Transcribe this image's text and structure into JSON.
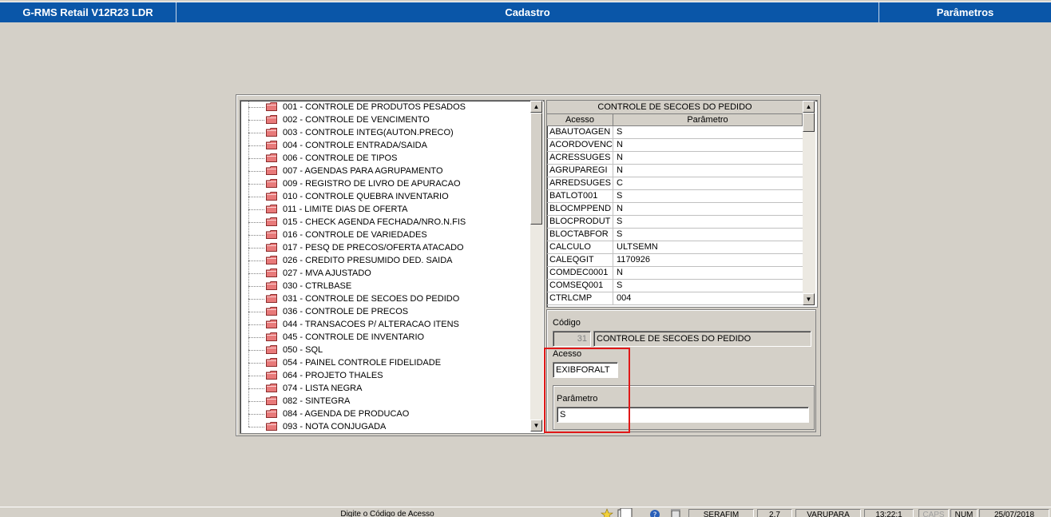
{
  "titlebar": {
    "app": "G-RMS Retail V12R23 LDR",
    "module": "Cadastro",
    "screen": "Parâmetros"
  },
  "tree": {
    "items": [
      "001 - CONTROLE DE PRODUTOS PESADOS",
      "002 - CONTROLE DE VENCIMENTO",
      "003 - CONTROLE INTEG(AUTON.PRECO)",
      "004 - CONTROLE ENTRADA/SAIDA",
      "006 - CONTROLE DE TIPOS",
      "007 - AGENDAS PARA AGRUPAMENTO",
      "009 - REGISTRO DE LIVRO DE APURACAO",
      "010 - CONTROLE QUEBRA INVENTARIO",
      "011 - LIMITE DIAS DE OFERTA",
      "015 - CHECK AGENDA FECHADA/NRO.N.FIS",
      "016 - CONTROLE DE VARIEDADES",
      "017 - PESQ DE PRECOS/OFERTA ATACADO",
      "026 - CREDITO PRESUMIDO DED. SAIDA",
      "027 - MVA AJUSTADO",
      "030 - CTRLBASE",
      "031 - CONTROLE DE SECOES DO PEDIDO",
      "036 - CONTROLE DE PRECOS",
      "044 - TRANSACOES P/ ALTERACAO ITENS",
      "045 - CONTROLE DE INVENTARIO",
      "050 - SQL",
      "054 - PAINEL CONTROLE FIDELIDADE",
      "064 - PROJETO THALES",
      "074 - LISTA NEGRA",
      "082 - SINTEGRA",
      "084 - AGENDA DE PRODUCAO",
      "093 - NOTA CONJUGADA"
    ]
  },
  "grid": {
    "caption": "CONTROLE DE SECOES DO PEDIDO",
    "col_acesso": "Acesso",
    "col_parametro": "Parâmetro",
    "rows": [
      [
        "ABAUTOAGEN",
        "S"
      ],
      [
        "ACORDOVENC",
        "N"
      ],
      [
        "ACRESSUGES",
        "N"
      ],
      [
        "AGRUPAREGI",
        "N"
      ],
      [
        "ARREDSUGES",
        "C"
      ],
      [
        "BATLOT001",
        "S"
      ],
      [
        "BLOCMPPEND",
        "N"
      ],
      [
        "BLOCPRODUT",
        "S"
      ],
      [
        "BLOCTABFOR",
        "S"
      ],
      [
        "CALCULO",
        "ULTSEMN"
      ],
      [
        "CALEQGIT",
        "1170926"
      ],
      [
        "COMDEC0001",
        "N"
      ],
      [
        "COMSEQ001",
        "S"
      ],
      [
        "CTRLCMP",
        "004"
      ]
    ]
  },
  "detail": {
    "codigo_label": "Código",
    "codigo_value": "31",
    "codigo_desc": "CONTROLE DE SECOES DO PEDIDO",
    "acesso_label": "Acesso",
    "acesso_value": "EXIBFORALT",
    "parametro_label": "Parâmetro",
    "parametro_value": "S"
  },
  "statusbar": {
    "hint": "Digite o Código de Acesso",
    "user": "SERAFIM",
    "version": "2.7",
    "store": "VARUPARA",
    "time": "13:22:1",
    "caps": "CAPS",
    "num": "NUM",
    "date": "25/07/2018"
  },
  "colors": {
    "titlebar": "#0a56a8",
    "background": "#d4d0c8",
    "highlight": "#e01818",
    "folder": "#e87a7a"
  }
}
